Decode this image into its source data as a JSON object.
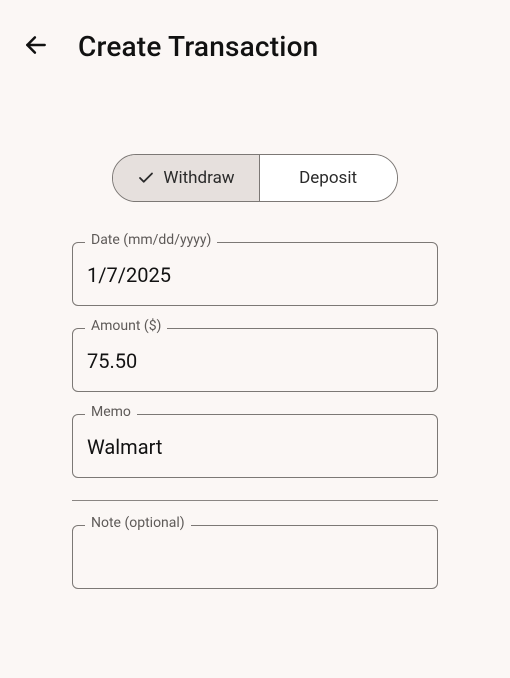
{
  "header": {
    "title": "Create Transaction"
  },
  "toggle": {
    "options": [
      {
        "label": "Withdraw",
        "selected": true
      },
      {
        "label": "Deposit",
        "selected": false
      }
    ]
  },
  "fields": {
    "date": {
      "label": "Date (mm/dd/yyyy)",
      "value": "1/7/2025"
    },
    "amount": {
      "label": "Amount ($)",
      "value": "75.50"
    },
    "memo": {
      "label": "Memo",
      "value": "Walmart"
    },
    "note": {
      "label": "Note (optional)",
      "value": ""
    }
  }
}
